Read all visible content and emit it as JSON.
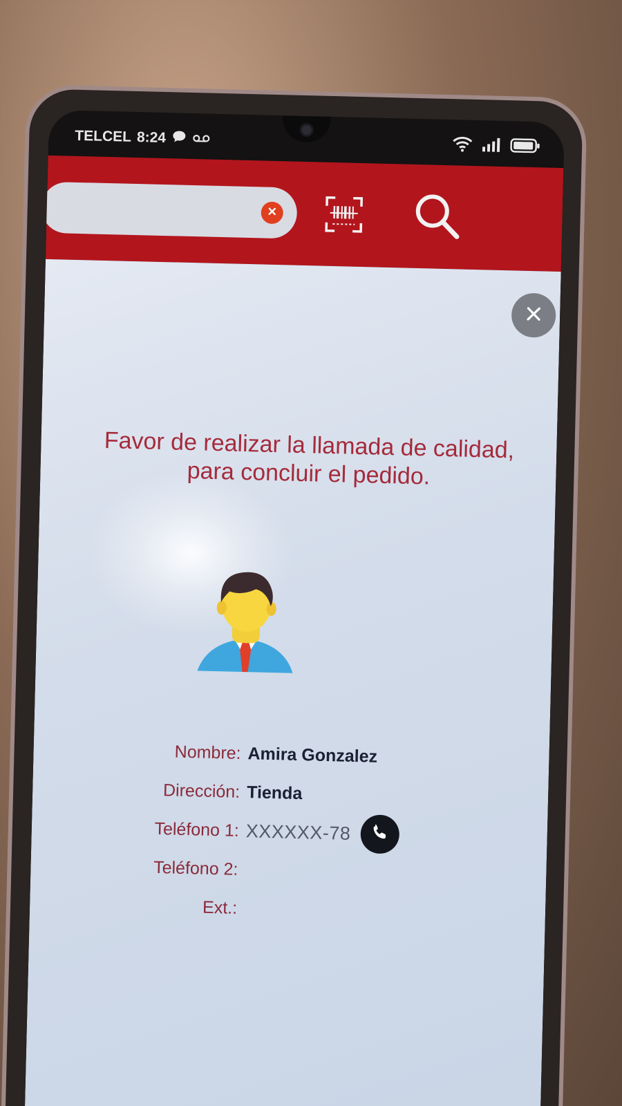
{
  "status_bar": {
    "carrier": "TELCEL",
    "time": "8:24",
    "icons": [
      "chat-bubble-icon",
      "voicemail-icon",
      "wifi-icon",
      "signal-icon",
      "battery-icon"
    ]
  },
  "header": {
    "search_value": "",
    "icons": {
      "clear": "clear-icon",
      "barcode": "barcode-scan-icon",
      "search": "search-icon"
    },
    "color": "#b3151d"
  },
  "dialog": {
    "close_icon": "close-icon",
    "message": "Favor de realizar la llamada de calidad, para concluir el pedido.",
    "avatar_icon": "person-avatar-icon",
    "fields": [
      {
        "label": "Nombre:",
        "value": "Amira Gonzalez"
      },
      {
        "label": "Dirección:",
        "value": "Tienda"
      },
      {
        "label": "Teléfono 1:",
        "value": "XXXXXX-78"
      },
      {
        "label": "Teléfono 2:",
        "value": ""
      },
      {
        "label": "Ext.:",
        "value": ""
      }
    ],
    "call_icon": "phone-call-icon"
  },
  "colors": {
    "accent": "#b3151d",
    "message_text": "#a52a3a",
    "label_text": "#8a2a3a",
    "value_text": "#1c2033"
  }
}
